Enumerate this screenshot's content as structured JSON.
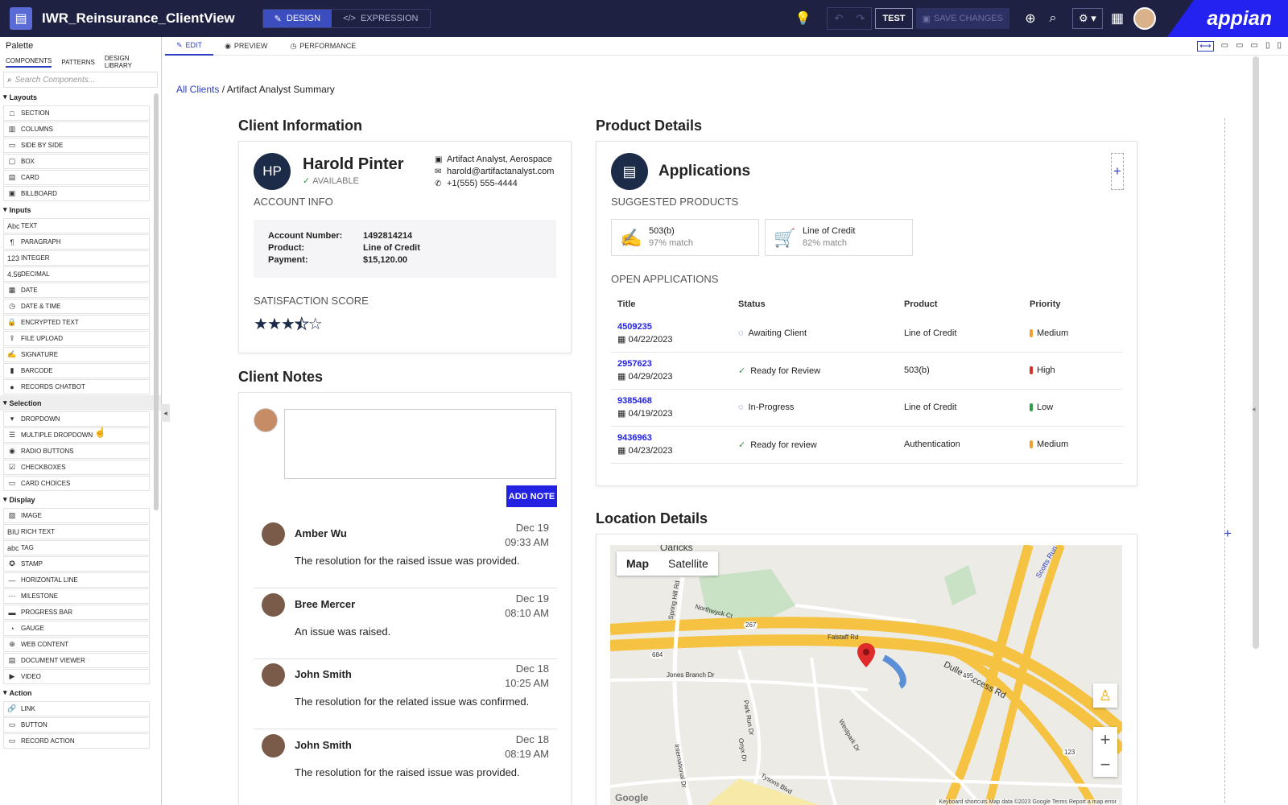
{
  "header": {
    "app_title": "IWR_Reinsurance_ClientView",
    "design_label": "DESIGN",
    "expression_label": "EXPRESSION",
    "test_label": "TEST",
    "save_label": "SAVE CHANGES",
    "brand": "appian"
  },
  "palette": {
    "title": "Palette",
    "tabs": [
      "COMPONENTS",
      "PATTERNS",
      "DESIGN LIBRARY"
    ],
    "search_placeholder": "Search Components...",
    "groups": [
      {
        "name": "Layouts",
        "items": [
          {
            "icon": "□",
            "label": "SECTION"
          },
          {
            "icon": "▥",
            "label": "COLUMNS"
          },
          {
            "icon": "▭",
            "label": "SIDE BY SIDE"
          },
          {
            "icon": "▢",
            "label": "BOX"
          },
          {
            "icon": "▤",
            "label": "CARD"
          },
          {
            "icon": "▣",
            "label": "BILLBOARD"
          }
        ]
      },
      {
        "name": "Inputs",
        "items": [
          {
            "icon": "Abc",
            "label": "TEXT"
          },
          {
            "icon": "¶",
            "label": "PARAGRAPH"
          },
          {
            "icon": "123",
            "label": "INTEGER"
          },
          {
            "icon": "4.56",
            "label": "DECIMAL"
          },
          {
            "icon": "▦",
            "label": "DATE"
          },
          {
            "icon": "◷",
            "label": "DATE & TIME"
          },
          {
            "icon": "🔒",
            "label": "ENCRYPTED TEXT"
          },
          {
            "icon": "⇪",
            "label": "FILE UPLOAD"
          },
          {
            "icon": "✍",
            "label": "SIGNATURE"
          },
          {
            "icon": "▮",
            "label": "BARCODE"
          },
          {
            "icon": "●",
            "label": "RECORDS CHATBOT"
          }
        ]
      },
      {
        "name": "Selection",
        "items": [
          {
            "icon": "▾",
            "label": "DROPDOWN"
          },
          {
            "icon": "☰",
            "label": "MULTIPLE DROPDOWN"
          },
          {
            "icon": "◉",
            "label": "RADIO BUTTONS"
          },
          {
            "icon": "☑",
            "label": "CHECKBOXES"
          },
          {
            "icon": "▭",
            "label": "CARD CHOICES"
          }
        ]
      },
      {
        "name": "Display",
        "items": [
          {
            "icon": "▨",
            "label": "IMAGE"
          },
          {
            "icon": "BIU",
            "label": "RICH TEXT"
          },
          {
            "icon": "abc",
            "label": "TAG"
          },
          {
            "icon": "✪",
            "label": "STAMP"
          },
          {
            "icon": "—",
            "label": "HORIZONTAL LINE"
          },
          {
            "icon": "⋯",
            "label": "MILESTONE"
          },
          {
            "icon": "▬",
            "label": "PROGRESS BAR"
          },
          {
            "icon": "◔",
            "label": "GAUGE"
          },
          {
            "icon": "⊕",
            "label": "WEB CONTENT"
          },
          {
            "icon": "▤",
            "label": "DOCUMENT VIEWER"
          },
          {
            "icon": "▶",
            "label": "VIDEO"
          }
        ]
      },
      {
        "name": "Action",
        "items": [
          {
            "icon": "🔗",
            "label": "LINK"
          },
          {
            "icon": "▭",
            "label": "BUTTON"
          },
          {
            "icon": "▭",
            "label": "RECORD ACTION"
          }
        ]
      }
    ]
  },
  "subbar": {
    "edit": "EDIT",
    "preview": "PREVIEW",
    "performance": "PERFORMANCE"
  },
  "breadcrumb": {
    "link": "All Clients",
    "current": " / Artifact Analyst Summary"
  },
  "client_info": {
    "section_title": "Client Information",
    "initials": "HP",
    "name": "Harold Pinter",
    "status": "AVAILABLE",
    "company": "Artifact Analyst, Aerospace",
    "email": "harold@artifactanalyst.com",
    "phone": "+1(555) 555-4444",
    "account_info_label": "ACCOUNT INFO",
    "account": [
      {
        "k": "Account Number:",
        "v": "1492814214"
      },
      {
        "k": "Product:",
        "v": "Line of Credit"
      },
      {
        "k": "Payment:",
        "v": "$15,120.00"
      }
    ],
    "satisfaction_label": "SATISFACTION SCORE",
    "satisfaction_score": 3.5,
    "satisfaction_max": 5
  },
  "notes": {
    "section_title": "Client Notes",
    "add_label": "ADD NOTE",
    "items": [
      {
        "name": "Amber Wu",
        "date": "Dec 19",
        "time": "09:33 AM",
        "text": "The resolution for the raised issue was provided."
      },
      {
        "name": "Bree Mercer",
        "date": "Dec 19",
        "time": "08:10 AM",
        "text": "An issue was raised."
      },
      {
        "name": "John Smith",
        "date": "Dec 18",
        "time": "10:25 AM",
        "text": "The resolution for the related issue was confirmed."
      },
      {
        "name": "John Smith",
        "date": "Dec 18",
        "time": "08:19 AM",
        "text": "The resolution for the raised issue was provided."
      }
    ]
  },
  "product": {
    "section_title": "Product Details",
    "app_title": "Applications",
    "suggested_label": "SUGGESTED PRODUCTS",
    "suggested": [
      {
        "name": "503(b)",
        "match": "97% match"
      },
      {
        "name": "Line of Credit",
        "match": "82% match"
      }
    ],
    "open_label": "OPEN APPLICATIONS",
    "columns": [
      "Title",
      "Status",
      "Product",
      "Priority"
    ],
    "rows": [
      {
        "id": "4509235",
        "date": "04/22/2023",
        "status": "Awaiting Client",
        "status_type": "pending",
        "product": "Line of Credit",
        "priority": "Medium",
        "priority_color": "#f0a030"
      },
      {
        "id": "2957623",
        "date": "04/29/2023",
        "status": "Ready for Review",
        "status_type": "done",
        "product": "503(b)",
        "priority": "High",
        "priority_color": "#d9302c"
      },
      {
        "id": "9385468",
        "date": "04/19/2023",
        "status": "In-Progress",
        "status_type": "pending",
        "product": "Line of Credit",
        "priority": "Low",
        "priority_color": "#2f9e47"
      },
      {
        "id": "9436963",
        "date": "04/23/2023",
        "status": "Ready for review",
        "status_type": "done",
        "product": "Authentication",
        "priority": "Medium",
        "priority_color": "#f0a030"
      }
    ]
  },
  "location": {
    "section_title": "Location Details",
    "map_label": "Map",
    "satellite_label": "Satellite",
    "places": [
      "Oaricks",
      "Spring Hill Rd",
      "Northwyck Ct",
      "Dulles Access Rd",
      "Jones Branch Dr",
      "Westpark Dr",
      "International Dr",
      "Tysons Blvd",
      "Scotts Run",
      "Falstaff Rd",
      "Park Run Dr",
      "Onyx Dr"
    ],
    "route_shields": [
      "267",
      "684",
      "495",
      "123"
    ],
    "attribution": "Keyboard shortcuts   Map data ©2023 Google   Terms   Report a map error",
    "google": "Google"
  }
}
